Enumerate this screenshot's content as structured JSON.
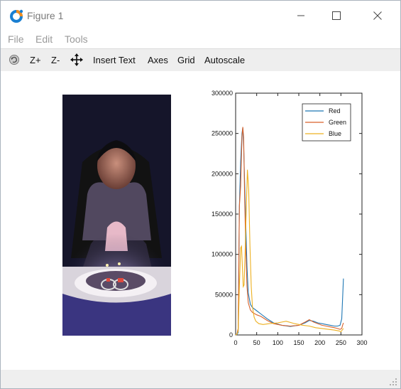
{
  "window": {
    "title": "Figure 1"
  },
  "menu": {
    "file": "File",
    "edit": "Edit",
    "tools": "Tools"
  },
  "toolbar": {
    "rotate_icon": "rotate-icon",
    "zoom_in": "Z+",
    "zoom_out": "Z-",
    "pan_icon": "pan-icon",
    "insert_text": "Insert Text",
    "axes": "Axes",
    "grid": "Grid",
    "autoscale": "Autoscale"
  },
  "colors": {
    "red": "#1f77b4",
    "green": "#d9622b",
    "blue": "#edb020"
  },
  "chart_data": {
    "type": "line",
    "title": "",
    "xlabel": "",
    "ylabel": "",
    "xlim": [
      0,
      300
    ],
    "ylim": [
      0,
      300000
    ],
    "x_ticks": [
      "0",
      "50",
      "100",
      "150",
      "200",
      "250",
      "300"
    ],
    "y_ticks": [
      "0",
      "50000",
      "100000",
      "150000",
      "200000",
      "250000",
      "300000"
    ],
    "grid": false,
    "legend": {
      "position": "top-right"
    },
    "series": [
      {
        "name": "Red",
        "color": "#1f77b4",
        "x": [
          0,
          3,
          6,
          9,
          12,
          15,
          17,
          19,
          21,
          24,
          27,
          30,
          35,
          40,
          50,
          60,
          75,
          90,
          110,
          130,
          150,
          165,
          175,
          185,
          195,
          205,
          215,
          225,
          235,
          242,
          248,
          252,
          254,
          256
        ],
        "y": [
          0,
          500,
          3000,
          160000,
          215000,
          250000,
          257000,
          235000,
          195000,
          140000,
          85000,
          52000,
          38000,
          34000,
          30000,
          26000,
          20000,
          15000,
          12000,
          10500,
          12000,
          15000,
          18000,
          17000,
          15000,
          14000,
          13000,
          12000,
          11000,
          11000,
          12000,
          20000,
          45000,
          70000
        ]
      },
      {
        "name": "Green",
        "color": "#d9622b",
        "x": [
          0,
          3,
          6,
          9,
          12,
          15,
          17,
          19,
          21,
          24,
          27,
          30,
          35,
          40,
          50,
          60,
          75,
          90,
          110,
          130,
          150,
          165,
          175,
          185,
          195,
          205,
          215,
          225,
          235,
          242,
          248,
          252,
          254,
          256
        ],
        "y": [
          0,
          1000,
          8000,
          160000,
          185000,
          245000,
          258000,
          245000,
          180000,
          110000,
          60000,
          40000,
          31000,
          28000,
          25000,
          23000,
          18000,
          14000,
          12000,
          11000,
          12000,
          16000,
          19000,
          16000,
          14000,
          12000,
          11000,
          10000,
          9000,
          8000,
          7000,
          8000,
          12000,
          15000
        ]
      },
      {
        "name": "Blue",
        "color": "#edb020",
        "x": [
          0,
          3,
          6,
          9,
          12,
          14,
          16,
          18,
          20,
          22,
          25,
          28,
          31,
          34,
          37,
          40,
          44,
          48,
          55,
          65,
          80,
          100,
          120,
          140,
          160,
          175,
          190,
          205,
          220,
          235,
          245,
          250,
          253,
          256
        ],
        "y": [
          0,
          1000,
          5000,
          60000,
          108000,
          110000,
          85000,
          60000,
          62000,
          95000,
          150000,
          205000,
          180000,
          110000,
          60000,
          35000,
          22000,
          17000,
          14000,
          13000,
          14000,
          15000,
          17000,
          14000,
          12000,
          11000,
          9000,
          8000,
          7000,
          6000,
          5000,
          4000,
          6000,
          8000
        ]
      }
    ]
  }
}
